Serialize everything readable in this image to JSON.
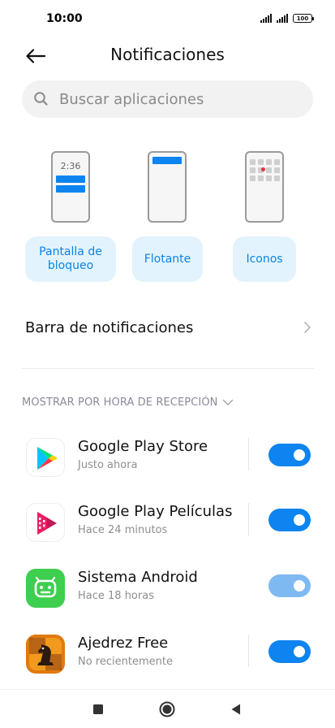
{
  "status": {
    "time": "10:00",
    "battery": "100"
  },
  "header": {
    "title": "Notificaciones",
    "back_icon": "arrow-left-icon"
  },
  "search": {
    "placeholder": "Buscar aplicaciones",
    "icon": "search-icon"
  },
  "styles": {
    "lock_preview_time": "2:36",
    "lockscreen_label": "Pantalla de bloqueo",
    "floating_label": "Flotante",
    "icons_label": "Iconos"
  },
  "notification_bar": {
    "label": "Barra de notificaciones"
  },
  "sort": {
    "label": "MOSTRAR POR HORA DE RECEPCIÓN"
  },
  "apps": [
    {
      "name": "Google Play Store",
      "subtitle": "Justo ahora",
      "enabled": true,
      "icon": "play-store-icon"
    },
    {
      "name": "Google Play Películas",
      "subtitle": "Hace 24 minutos",
      "enabled": true,
      "icon": "play-movies-icon"
    },
    {
      "name": "Sistema Android",
      "subtitle": "Hace 18 horas",
      "enabled": true,
      "locked": true,
      "icon": "android-icon"
    },
    {
      "name": "Ajedrez Free",
      "subtitle": "No recientemente",
      "enabled": true,
      "icon": "chess-icon"
    }
  ],
  "colors": {
    "accent": "#0d84ef",
    "accent_dim": "#7fb9f2",
    "chip_bg": "#e3f3fd"
  }
}
